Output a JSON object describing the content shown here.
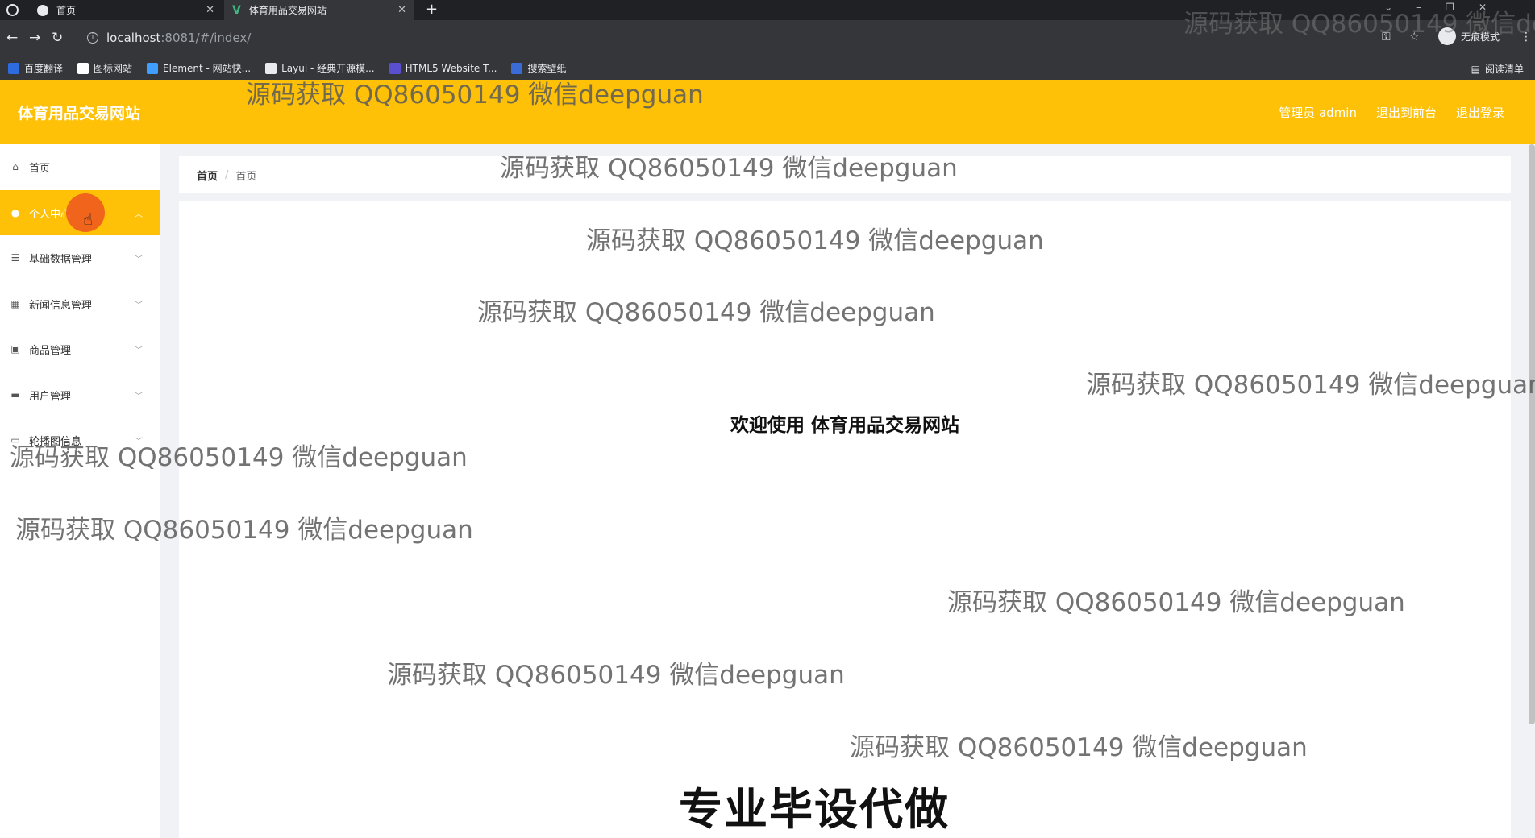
{
  "browser": {
    "tabs": [
      {
        "label": "首页"
      },
      {
        "label": "体育用品交易网站"
      }
    ],
    "url_host": "localhost",
    "url_path": ":8081/#/index/",
    "incognito_label": "无痕模式",
    "bookmarks": [
      {
        "label": "百度翻译",
        "color": "#2e6bde"
      },
      {
        "label": "图标网站",
        "color": "#ffffff"
      },
      {
        "label": "Element - 网站快...",
        "color": "#409eff"
      },
      {
        "label": "Layui - 经典开源模...",
        "color": "#e8eaed"
      },
      {
        "label": "HTML5 Website T...",
        "color": "#5a4fcf"
      },
      {
        "label": "搜索壁纸",
        "color": "#3b6bd6"
      }
    ],
    "reading_list": "阅读清单"
  },
  "header": {
    "title": "体育用品交易网站",
    "admin_label": "管理员 admin",
    "back_to_front": "退出到前台",
    "logout": "退出登录",
    "accent_color": "#ffc107"
  },
  "sidebar": {
    "items": [
      {
        "label": "首页",
        "icon": "home-icon"
      },
      {
        "label": "个人中心",
        "icon": "user-icon",
        "active": true
      },
      {
        "label": "基础数据管理",
        "icon": "list-icon"
      },
      {
        "label": "新闻信息管理",
        "icon": "grid-icon"
      },
      {
        "label": "商品管理",
        "icon": "clipboard-icon"
      },
      {
        "label": "用户管理",
        "icon": "monitor-icon"
      },
      {
        "label": "轮播图信息",
        "icon": "image-icon"
      }
    ]
  },
  "breadcrumb": {
    "first": "首页",
    "second": "首页"
  },
  "main": {
    "welcome": "欢迎使用 体育用品交易网站"
  },
  "watermark_text": "源码获取 QQ86050149 微信deepguan",
  "banner_text": "专业毕设代做"
}
